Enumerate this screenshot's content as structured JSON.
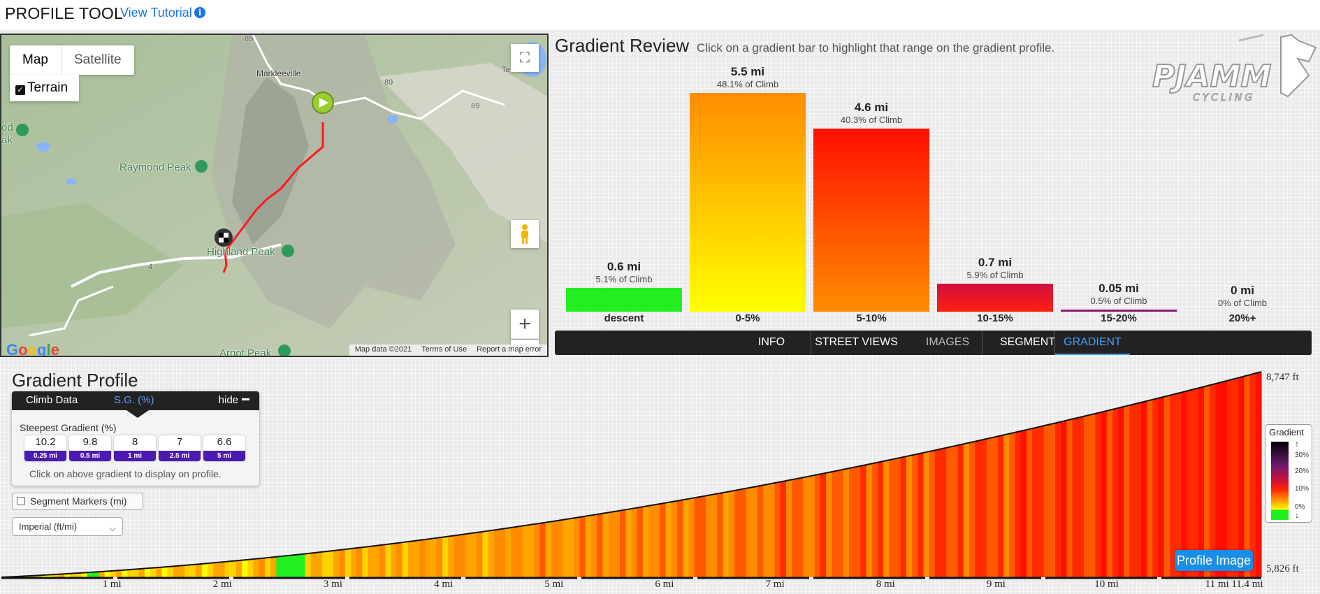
{
  "app": {
    "title": "PROFILE TOOL",
    "tutorial_link": "View Tutorial",
    "info_icon_glyph": "i"
  },
  "map": {
    "type_options": [
      "Map",
      "Satellite"
    ],
    "selected_type": "Map",
    "terrain_label": "Terrain",
    "terrain_checked": true,
    "places": [
      "Markleeville",
      "Raymond Peak",
      "Highland Peak",
      "od\nak",
      "Arnot Peak"
    ],
    "road_shields": [
      "89",
      "89",
      "89",
      "4"
    ],
    "footer": [
      "Map data ©2021",
      "Terms of Use",
      "Report a map error"
    ],
    "logo_text": "Google",
    "zoom_in_glyph": "+",
    "zoom_out_glyph": "−",
    "fullscreen_glyph": "⛶",
    "top_right_fragment": "Te"
  },
  "gradient_review": {
    "title": "Gradient Review",
    "subtitle": "Click on a gradient bar to highlight that range on the gradient profile.",
    "bars": [
      {
        "distance": "0.6 mi",
        "percent": "5.1% of Climb",
        "label": "descent",
        "value": 0.6,
        "color_top": "#22ee22",
        "color_bottom": "#22ee22"
      },
      {
        "distance": "5.5 mi",
        "percent": "48.1% of Climb",
        "label": "0-5%",
        "value": 5.5,
        "color_top": "#ff8c00",
        "color_bottom": "#ffff00"
      },
      {
        "distance": "4.6 mi",
        "percent": "40.3% of Climb",
        "label": "5-10%",
        "value": 4.6,
        "color_top": "#ff0f00",
        "color_bottom": "#ff8c00"
      },
      {
        "distance": "0.7 mi",
        "percent": "5.9% of Climb",
        "label": "10-15%",
        "value": 0.7,
        "color_top": "#d00f3f",
        "color_bottom": "#ff1f0f"
      },
      {
        "distance": "0.05 mi",
        "percent": "0.5% of Climb",
        "label": "15-20%",
        "value": 0.05,
        "color_top": "#8a1a6e",
        "color_bottom": "#8a1a6e"
      },
      {
        "distance": "0 mi",
        "percent": "0% of Climb",
        "label": "20%+",
        "value": 0,
        "color_top": "#000",
        "color_bottom": "#000"
      }
    ],
    "max_value": 5.5
  },
  "brand": {
    "name": "PJAMM",
    "tagline": "CYCLING"
  },
  "nav": {
    "items": [
      "INFO",
      "STREET VIEWS",
      "IMAGES",
      "SEGMENT",
      "GRADIENT"
    ],
    "active": "GRADIENT",
    "accent": "#3da3ff"
  },
  "profile": {
    "title": "Gradient Profile",
    "climb_tab": "Climb Data",
    "sg_tab": "S.G. (%)",
    "hide_label": "hide",
    "steepest_label": "Steepest Gradient (%)",
    "steepest": [
      {
        "value": "10.2",
        "distance": "0.25 mi"
      },
      {
        "value": "9.8",
        "distance": "0.5 mi"
      },
      {
        "value": "8",
        "distance": "1 mi"
      },
      {
        "value": "7",
        "distance": "2.5 mi"
      },
      {
        "value": "6.6",
        "distance": "5 mi"
      }
    ],
    "hint": "Click on above gradient to display on profile.",
    "segment_markers_label": "Segment Markers (mi)",
    "segment_markers_checked": false,
    "units_value": "Imperial (ft/mi)",
    "elev_max": "8,747 ft",
    "elev_min": "5,826 ft",
    "elev_max_value": 8747,
    "elev_min_value": 5826,
    "total_distance": 11.4,
    "mile_labels": [
      "1 mi",
      "2 mi",
      "3 mi",
      "4 mi",
      "5 mi",
      "6 mi",
      "7 mi",
      "8 mi",
      "9 mi",
      "10 mi",
      "11 mi",
      "11.4 mi"
    ],
    "mile_values": [
      1,
      2,
      3,
      4,
      5,
      6,
      7,
      8,
      9,
      10,
      11,
      11.4
    ],
    "profile_image_button": "Profile Image",
    "legend_title": "Gradient",
    "legend_ticks": [
      "30%",
      "20%",
      "10%",
      "0%"
    ],
    "legend_arrows": [
      "↑",
      "↓"
    ]
  },
  "chart_data": {
    "type": "bar",
    "categories": [
      "descent",
      "0-5%",
      "5-10%",
      "10-15%",
      "15-20%",
      "20%+"
    ],
    "values": [
      0.6,
      5.5,
      4.6,
      0.7,
      0.05,
      0
    ],
    "title": "Gradient Review",
    "ylabel": "",
    "xlabel": ""
  }
}
